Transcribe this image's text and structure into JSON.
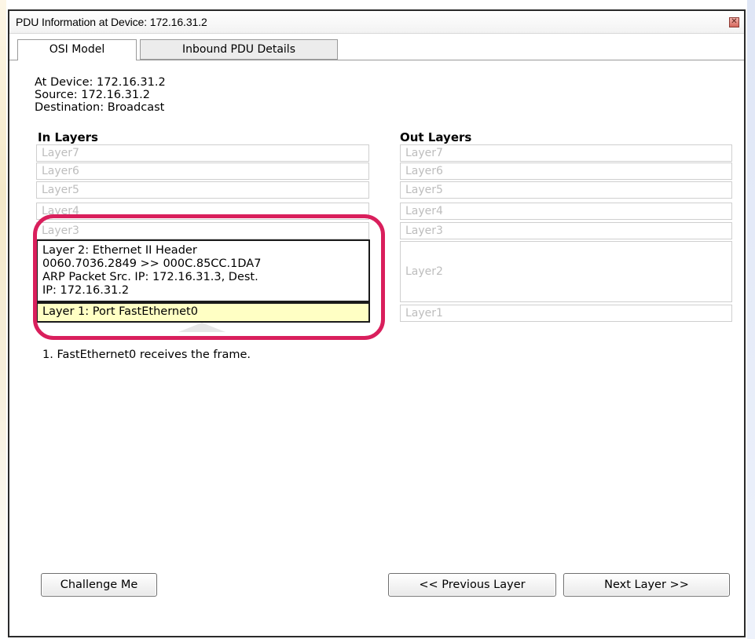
{
  "window": {
    "title": "PDU Information at Device: 172.16.31.2",
    "close_glyph": "✕"
  },
  "tabs": [
    {
      "label": "OSI Model",
      "active": true
    },
    {
      "label": "Inbound PDU Details",
      "active": false
    }
  ],
  "info": {
    "at_device": "At Device: 172.16.31.2",
    "source": "Source: 172.16.31.2",
    "destination": "Destination: Broadcast"
  },
  "in_layers": {
    "title": "In Layers",
    "layer7": "Layer7",
    "layer6": "Layer6",
    "layer5": "Layer5",
    "layer4": "Layer4",
    "layer3": "Layer3",
    "layer2_lines": [
      "Layer 2: Ethernet II Header",
      "0060.7036.2849 >> 000C.85CC.1DA7",
      "ARP Packet Src. IP: 172.16.31.3, Dest.",
      "IP: 172.16.31.2"
    ],
    "layer1": "Layer 1: Port FastEthernet0"
  },
  "out_layers": {
    "title": "Out Layers",
    "layer7": "Layer7",
    "layer6": "Layer6",
    "layer5": "Layer5",
    "layer4": "Layer4",
    "layer3": "Layer3",
    "layer2": "Layer2",
    "layer1": "Layer1"
  },
  "description": "1. FastEthernet0 receives the frame.",
  "buttons": {
    "challenge": "Challenge Me",
    "previous": "<< Previous Layer",
    "next": "Next Layer >>"
  },
  "colors": {
    "highlight": "#d91f5c",
    "selected_layer_bg": "#ffffc4",
    "inactive_text": "#bdbdbd"
  }
}
